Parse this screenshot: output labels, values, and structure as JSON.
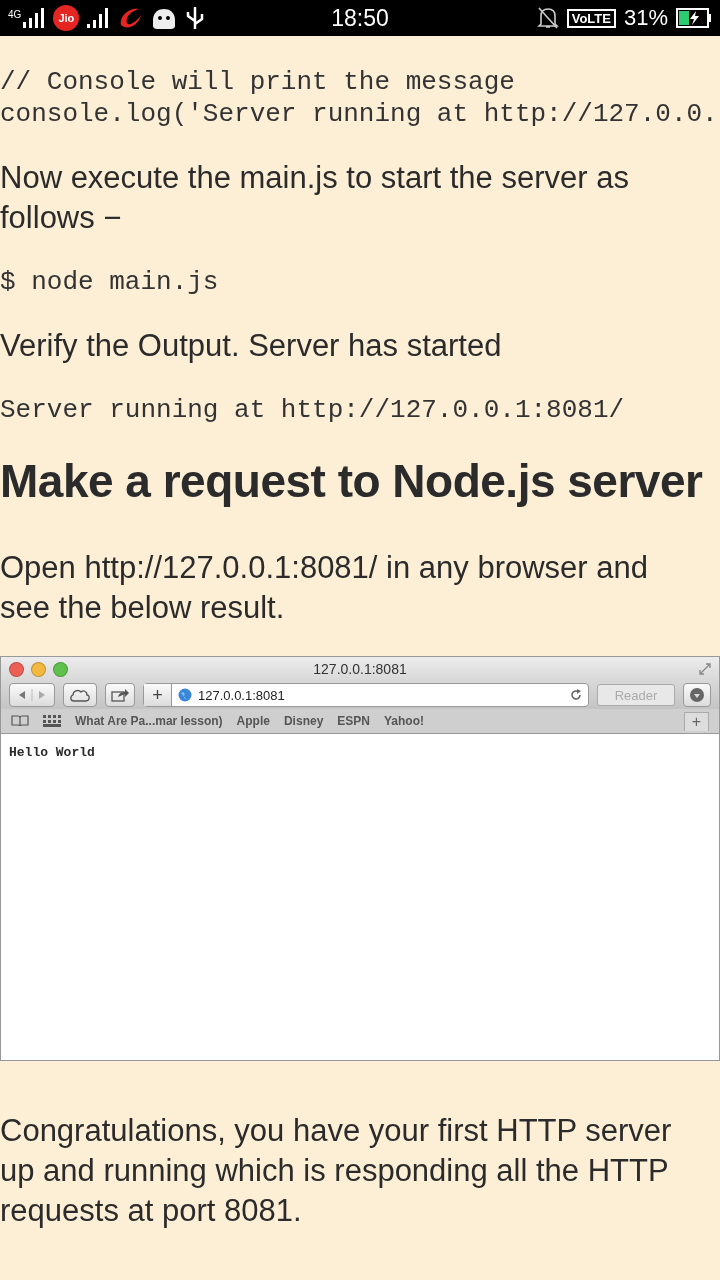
{
  "status_bar": {
    "network": "4G",
    "carrier": "Jio",
    "time": "18:50",
    "volte": "VoLTE",
    "battery": "31%"
  },
  "content": [
    {
      "kind": "code",
      "lines": [
        "// Console will print the message",
        "console.log('Server running at http://127.0.0."
      ]
    },
    {
      "kind": "paragraph",
      "text": "Now execute the main.js to start the server as follows −"
    },
    {
      "kind": "code",
      "lines": [
        "$ node main.js"
      ]
    },
    {
      "kind": "paragraph",
      "text": "Verify the Output. Server has started"
    },
    {
      "kind": "code",
      "lines": [
        "Server running at http://127.0.0.1:8081/"
      ]
    },
    {
      "kind": "heading",
      "text": "Make a request to Node.js server"
    },
    {
      "kind": "paragraph",
      "text": "Open http://127.0.0.1:8081/ in any browser and see the below result."
    },
    {
      "kind": "browser",
      "title": "127.0.0.1:8081",
      "address": "127.0.0.1:8081",
      "reader": "Reader",
      "bookmarks": [
        "What Are Pa...mar lesson)",
        "Apple",
        "Disney",
        "ESPN",
        "Yahoo!"
      ],
      "new_tab": "+",
      "add": "+",
      "body": "Hello World"
    },
    {
      "kind": "paragraph",
      "text": "Congratulations, you have your first HTTP server up and running which is responding all the HTTP requests at port 8081."
    }
  ]
}
